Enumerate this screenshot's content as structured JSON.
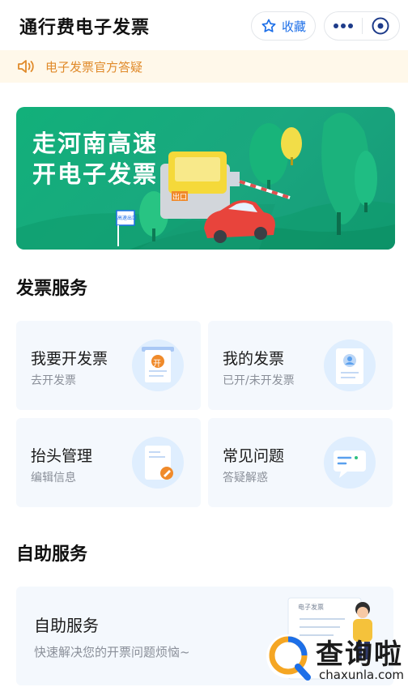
{
  "header": {
    "title": "通行费电子发票",
    "favorite_label": "收藏"
  },
  "notice": {
    "text": "电子发票官方答疑"
  },
  "banner": {
    "line1": "走河南高速",
    "line2": "开电子发票",
    "booth_sign": "出口",
    "post_sign": "高速出口"
  },
  "invoice_services": {
    "title": "发票服务",
    "cards": [
      {
        "title": "我要开发票",
        "subtitle": "去开发票",
        "icon": "invoice-issue-icon"
      },
      {
        "title": "我的发票",
        "subtitle": "已开/未开发票",
        "icon": "my-invoice-icon"
      },
      {
        "title": "抬头管理",
        "subtitle": "编辑信息",
        "icon": "title-edit-icon"
      },
      {
        "title": "常见问题",
        "subtitle": "答疑解惑",
        "icon": "faq-chat-icon"
      }
    ],
    "issue_badge": "开"
  },
  "self_service": {
    "title": "自助服务",
    "card_title": "自助服务",
    "card_subtitle": "快速解决您的开票问题烦恼~",
    "illustration_label": "电子发票"
  },
  "watermark": {
    "text": "查询啦",
    "domain": "chaxunla.com"
  },
  "colors": {
    "accent_blue": "#1d6fe8",
    "notice_bg": "#fff8ea",
    "notice_text": "#e08a2a",
    "banner_green": "#12b07a",
    "card_bg": "#f4f8fd"
  }
}
